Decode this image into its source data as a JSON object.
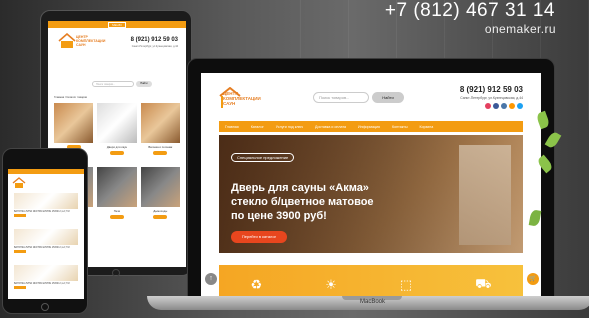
{
  "promo": {
    "phone": "+7 (812) 467 31 14",
    "site": "onemaker.ru"
  },
  "brand": {
    "logo_text": "ЦЕНТР КОМПЛЕКТАЦИИ САУН",
    "accent": "#f39c12",
    "cta": "#e8461e"
  },
  "tablet": {
    "menu_label": "МЕНЮ",
    "phone": "8 (921) 912 59 03",
    "address": "Санкт-Петербург, ул.Кузнецовская, д.44",
    "search_placeholder": "Поиск товаров...",
    "search_button": "Найти",
    "breadcrumb": "Главная / Каталог товаров",
    "cards": [
      {
        "caption": ""
      },
      {
        "caption": "Двери для саун"
      },
      {
        "caption": "Вагонка и погонаж"
      },
      {
        "caption": ""
      },
      {
        "caption": "Печи"
      },
      {
        "caption": "Дымоходы"
      }
    ]
  },
  "phone_device": {
    "items": [
      {
        "line": "ВАГОНКА ЛИПА ЭКСТРА ШТИЛЬ 15X90 2,1-2,7 М"
      },
      {
        "line": "ВАГОНКА ЛИПА ЭКСТРА ШТИЛЬ 15X90 2,1-2,7 М"
      },
      {
        "line": "ВАГОНКА ЛИПА ЭКСТРА ШТИЛЬ 15X90 2,1-2,7 М"
      }
    ]
  },
  "laptop": {
    "brand_label": "MacBook",
    "phone": "8 (921) 912 59 03",
    "address": "Санкт-Петербург, ул.Кузнецовская, д.44",
    "search_placeholder": "Поиск товаров...",
    "search_button": "Найти",
    "nav": [
      "Главная",
      "Каталог",
      "Услуги под ключ",
      "Доставка и оплата",
      "Информация",
      "Контакты",
      "Корзина"
    ],
    "hero": {
      "pill": "Специальное предложение",
      "title": "Дверь для сауны «Акма» стекло б/цветное матовое по цене 3900 руб!",
      "button": "Перейти в каталог"
    },
    "features": [
      "♻",
      "☀",
      "⬚",
      "⛟"
    ],
    "social_colors": [
      "#e4405f",
      "#3b5998",
      "#4a76a8",
      "#ff9800",
      "#1da1f2"
    ]
  }
}
